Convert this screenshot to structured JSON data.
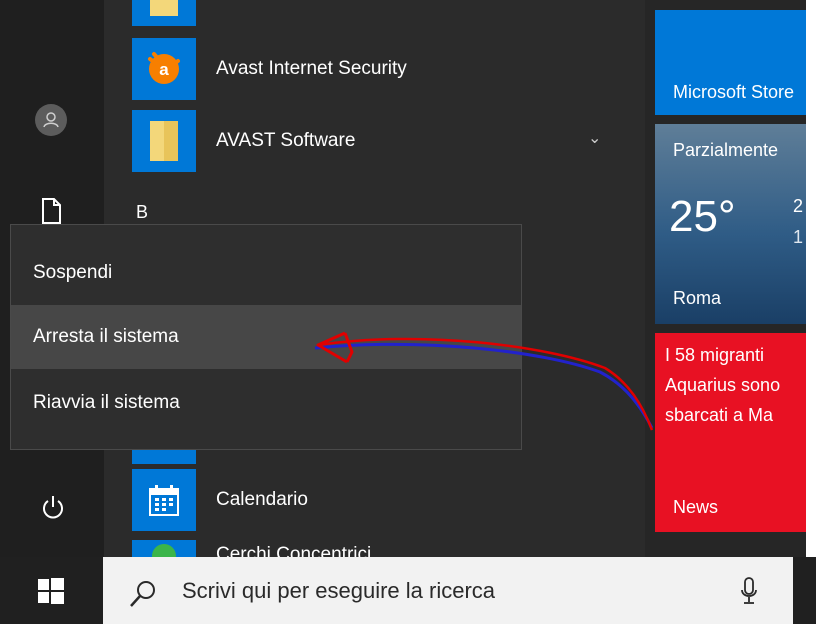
{
  "start_menu": {
    "apps": [
      {
        "label": "Avast Internet Security",
        "icon": "avast-icon",
        "color": "#f77f00"
      },
      {
        "label": "AVAST Software",
        "icon": "folder-icon",
        "color": "#f3d77a"
      },
      {
        "label": "B"
      },
      {
        "label": "Calendario",
        "icon": "calendar-icon",
        "color": "#0078d7"
      },
      {
        "label": "Cerchi Concentrici"
      }
    ],
    "left_rail": {
      "user": "user-icon",
      "documents": "document-icon",
      "power": "power-icon"
    }
  },
  "power_menu": {
    "items": [
      {
        "label": "Sospendi"
      },
      {
        "label": "Arresta il sistema",
        "highlighted": true
      },
      {
        "label": "Riavvia il sistema"
      }
    ]
  },
  "tiles": {
    "store": {
      "label": "Microsoft Store",
      "color": "#0078d7"
    },
    "weather": {
      "condition": "Parzialmente",
      "temperature": "25°",
      "hi": "2",
      "lo": "1",
      "city": "Roma"
    },
    "news": {
      "headline_1": "I 58 migranti",
      "headline_2": "Aquarius sono",
      "headline_3": "sbarcati a Ma",
      "label": "News",
      "color": "#e81123"
    }
  },
  "taskbar": {
    "start": "windows-icon",
    "search_placeholder": "Scrivi qui per eseguire la ricerca",
    "search_icon": "search-icon",
    "mic_icon": "microphone-icon"
  },
  "annotation": {
    "color_red": "#e00000",
    "color_blue": "#2222cc"
  }
}
